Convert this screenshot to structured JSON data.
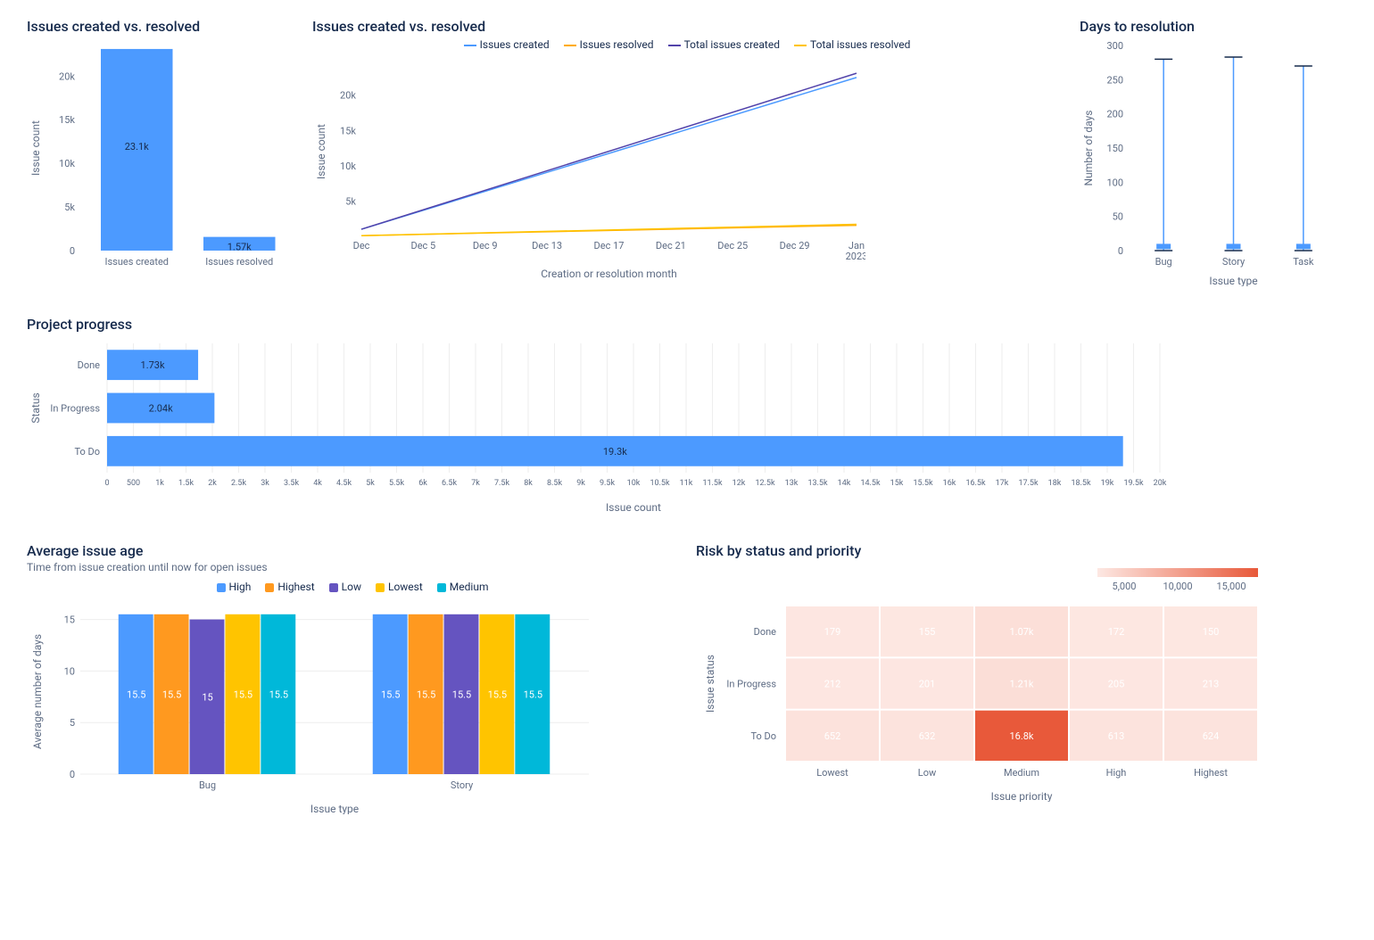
{
  "chart_data": [
    {
      "id": "bar1",
      "type": "bar",
      "title": "Issues created vs. resolved",
      "ylabel": "Issue count",
      "categories": [
        "Issues created",
        "Issues resolved"
      ],
      "values": [
        23100,
        1570
      ],
      "value_labels": [
        "23.1k",
        "1.57k"
      ],
      "y_ticks": [
        0,
        5000,
        10000,
        15000,
        20000
      ],
      "y_tick_labels": [
        "0",
        "5k",
        "10k",
        "15k",
        "20k"
      ]
    },
    {
      "id": "line1",
      "type": "line",
      "title": "Issues created vs. resolved",
      "xlabel": "Creation or resolution month",
      "ylabel": "Issue count",
      "x_ticks": [
        "Dec",
        "Dec 5",
        "Dec 9",
        "Dec 13",
        "Dec 17",
        "Dec 21",
        "Dec 25",
        "Dec 29",
        "Jan 2023"
      ],
      "y_ticks": [
        5000,
        10000,
        15000,
        20000
      ],
      "y_tick_labels": [
        "5k",
        "10k",
        "15k",
        "20k"
      ],
      "series": [
        {
          "name": "Issues created",
          "color": "#4C9AFF",
          "y0": 1000,
          "y1": 22500
        },
        {
          "name": "Issues resolved",
          "color": "#FFAB00",
          "y0": 100,
          "y1": 1570
        },
        {
          "name": "Total issues created",
          "color": "#5243AA",
          "y0": 1000,
          "y1": 23100
        },
        {
          "name": "Total issues resolved",
          "color": "#FFC400",
          "y0": 100,
          "y1": 1700
        }
      ]
    },
    {
      "id": "range1",
      "type": "range",
      "title": "Days to resolution",
      "xlabel": "Issue type",
      "ylabel": "Number of days",
      "categories": [
        "Bug",
        "Story",
        "Task"
      ],
      "ranges": [
        [
          0,
          280
        ],
        [
          0,
          283
        ],
        [
          0,
          270
        ]
      ],
      "means": [
        6,
        6,
        6
      ],
      "y_ticks": [
        0,
        50,
        100,
        150,
        200,
        250,
        300
      ]
    },
    {
      "id": "hbar1",
      "type": "hbar",
      "title": "Project progress",
      "xlabel": "Issue count",
      "ylabel": "Status",
      "categories": [
        "Done",
        "In Progress",
        "To Do"
      ],
      "values": [
        1730,
        2040,
        19300
      ],
      "value_labels": [
        "1.73k",
        "2.04k",
        "19.3k"
      ],
      "x_ticks": [
        0,
        500,
        1000,
        1500,
        2000,
        2500,
        3000,
        3500,
        4000,
        4500,
        5000,
        5500,
        6000,
        6500,
        7000,
        7500,
        8000,
        8500,
        9000,
        9500,
        10000,
        10500,
        11000,
        11500,
        12000,
        12500,
        13000,
        13500,
        14000,
        14500,
        15000,
        15500,
        16000,
        16500,
        17000,
        17500,
        18000,
        18500,
        19000,
        19500,
        20000
      ],
      "x_tick_labels": [
        "0",
        "500",
        "1k",
        "1.5k",
        "2k",
        "2.5k",
        "3k",
        "3.5k",
        "4k",
        "4.5k",
        "5k",
        "5.5k",
        "6k",
        "6.5k",
        "7k",
        "7.5k",
        "8k",
        "8.5k",
        "9k",
        "9.5k",
        "10k",
        "10.5k",
        "11k",
        "11.5k",
        "12k",
        "12.5k",
        "13k",
        "13.5k",
        "14k",
        "14.5k",
        "15k",
        "15.5k",
        "16k",
        "16.5k",
        "17k",
        "17.5k",
        "18k",
        "18.5k",
        "19k",
        "19.5k",
        "20k"
      ]
    },
    {
      "id": "grouped1",
      "type": "grouped-bar",
      "title": "Average issue age",
      "subtitle": "Time from issue creation until now for open issues",
      "xlabel": "Issue type",
      "ylabel": "Average number of days",
      "categories": [
        "Bug",
        "Story"
      ],
      "series": [
        {
          "name": "High",
          "color": "#4C9AFF",
          "values": [
            15.5,
            15.5
          ],
          "labels": [
            "15.5",
            "15.5"
          ]
        },
        {
          "name": "Highest",
          "color": "#FF991F",
          "values": [
            15.5,
            15.5
          ],
          "labels": [
            "15.5",
            "15.5"
          ]
        },
        {
          "name": "Low",
          "color": "#6554C0",
          "values": [
            15,
            15.5
          ],
          "labels": [
            "15",
            "15.5"
          ]
        },
        {
          "name": "Lowest",
          "color": "#FFC400",
          "values": [
            15.5,
            15.5
          ],
          "labels": [
            "15.5",
            "15.5"
          ]
        },
        {
          "name": "Medium",
          "color": "#00B8D9",
          "values": [
            15.5,
            15.5
          ],
          "labels": [
            "15.5",
            "15.5"
          ]
        }
      ],
      "y_ticks": [
        0,
        5,
        10,
        15
      ]
    },
    {
      "id": "heat1",
      "type": "heatmap",
      "title": "Risk by status and priority",
      "xlabel": "Issue priority",
      "ylabel": "Issue status",
      "rows": [
        "Done",
        "In Progress",
        "To Do"
      ],
      "cols": [
        "Lowest",
        "Low",
        "Medium",
        "High",
        "Highest"
      ],
      "cells": [
        [
          {
            "v": 179,
            "l": "179"
          },
          {
            "v": 155,
            "l": "155"
          },
          {
            "v": 1070,
            "l": "1.07k"
          },
          {
            "v": 172,
            "l": "172"
          },
          {
            "v": 150,
            "l": "150"
          }
        ],
        [
          {
            "v": 212,
            "l": "212"
          },
          {
            "v": 201,
            "l": "201"
          },
          {
            "v": 1210,
            "l": "1.21k"
          },
          {
            "v": 205,
            "l": "205"
          },
          {
            "v": 213,
            "l": "213"
          }
        ],
        [
          {
            "v": 652,
            "l": "652"
          },
          {
            "v": 632,
            "l": "632"
          },
          {
            "v": 16800,
            "l": "16.8k"
          },
          {
            "v": 613,
            "l": "613"
          },
          {
            "v": 624,
            "l": "624"
          }
        ]
      ],
      "legend_ticks": [
        "5,000",
        "10,000",
        "15,000"
      ],
      "max": 16800
    }
  ]
}
